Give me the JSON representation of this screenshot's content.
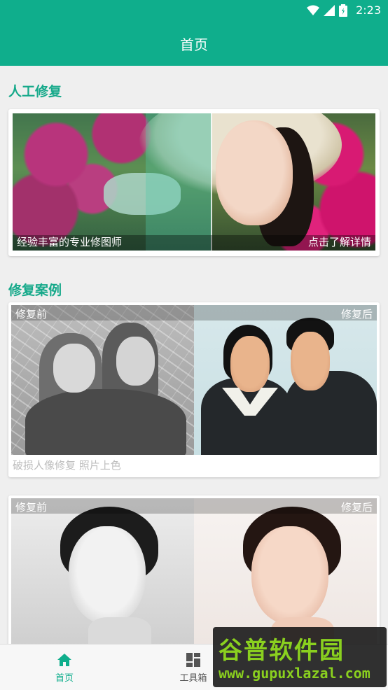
{
  "status_bar": {
    "time": "2:23",
    "icons": [
      "wifi-icon",
      "cell-signal-icon",
      "battery-icon"
    ]
  },
  "header": {
    "title": "首页"
  },
  "sections": {
    "manual": {
      "title": "人工修复",
      "caption_left": "经验丰富的专业修图师",
      "caption_right": "点击了解详情"
    },
    "cases": {
      "title": "修复案例",
      "items": [
        {
          "before_label": "修复前",
          "after_label": "修复后",
          "caption": "破损人像修复 照片上色"
        },
        {
          "before_label": "修复前",
          "after_label": "修复后",
          "caption": ""
        }
      ]
    }
  },
  "bottom_nav": {
    "items": [
      {
        "label": "首页",
        "icon": "home-icon",
        "active": true
      },
      {
        "label": "工具箱",
        "icon": "toolbox-icon",
        "active": false
      }
    ]
  },
  "watermark": {
    "title": "谷普软件园",
    "url": "www.gupuxlazal.com"
  },
  "colors": {
    "primary": "#0fae8c",
    "section_title": "#16a98a",
    "caption_gray": "#bdbdbd"
  }
}
